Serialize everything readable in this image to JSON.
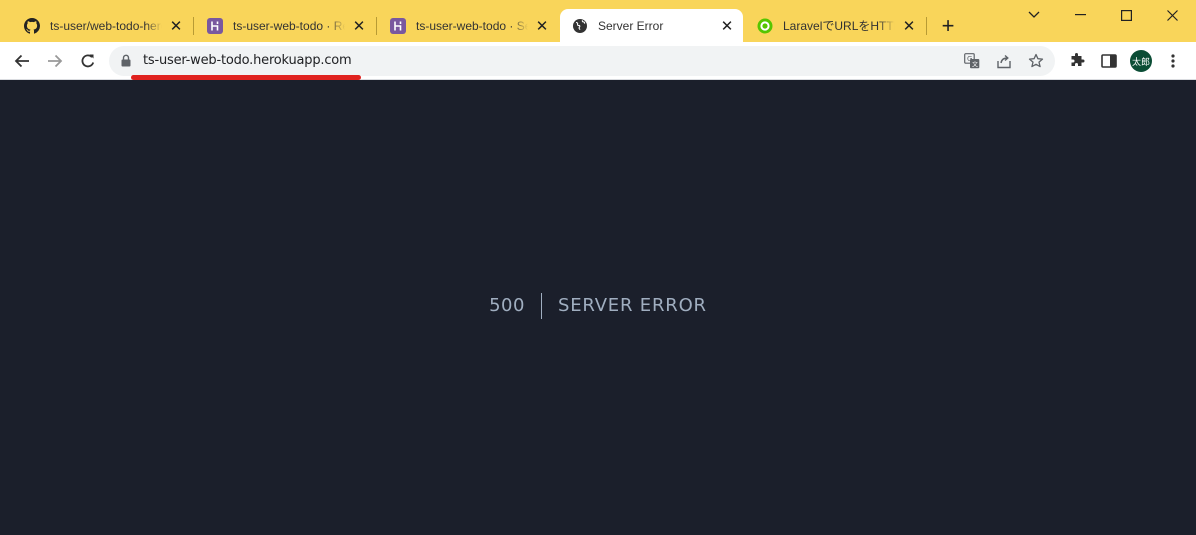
{
  "browser": {
    "tabs": [
      {
        "title": "ts-user/web-todo-heroku",
        "favicon": "github-icon",
        "active": false
      },
      {
        "title": "ts-user-web-todo · Resources",
        "favicon": "heroku-icon",
        "active": false
      },
      {
        "title": "ts-user-web-todo · Settings",
        "favicon": "heroku-icon",
        "active": false
      },
      {
        "title": "Server Error",
        "favicon": "globe-icon",
        "active": true
      },
      {
        "title": "LaravelでURLをHTTPSに",
        "favicon": "qiita-icon",
        "active": false
      }
    ],
    "url": "ts-user-web-todo.herokuapp.com",
    "profile_initials": "太郎",
    "colors": {
      "tabstrip": "#f9d55a",
      "active_tab": "#ffffff",
      "url_highlight": "#e0221f"
    }
  },
  "page": {
    "error_code": "500",
    "error_message": "SERVER ERROR",
    "background": "#1b1f2b",
    "text_color": "#a0aec0"
  }
}
